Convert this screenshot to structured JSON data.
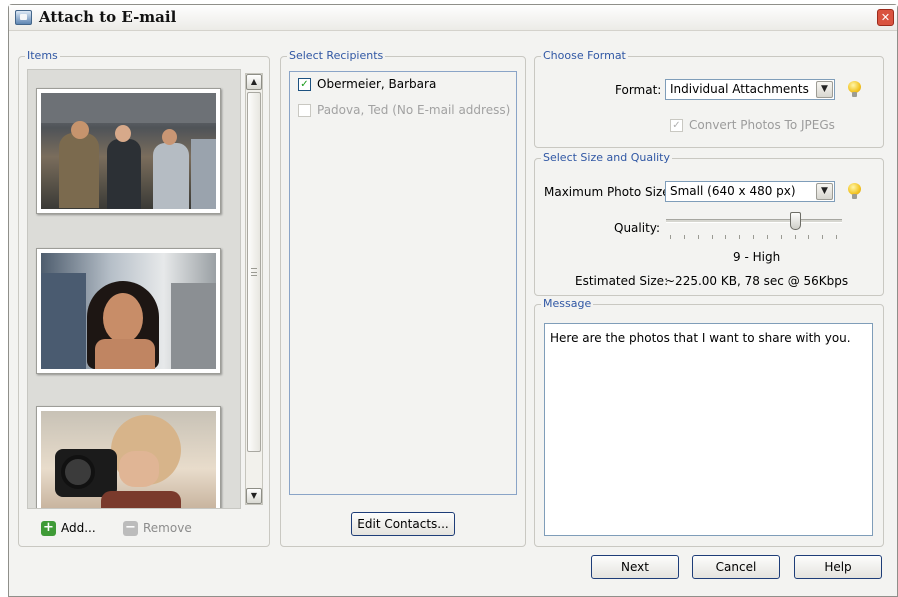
{
  "window": {
    "title": "Attach to E-mail",
    "close_icon": "close-icon",
    "close_glyph": "✕"
  },
  "items": {
    "label": "Items",
    "thumbnails": [
      {
        "description_icon": "photo-thumbnail"
      },
      {
        "description_icon": "photo-thumbnail"
      },
      {
        "description_icon": "photo-thumbnail"
      }
    ],
    "scroll_up_glyph": "▲",
    "scroll_down_glyph": "▼",
    "add_label": "Add...",
    "remove_label": "Remove",
    "add_glyph": "+",
    "remove_glyph": "−"
  },
  "recipients": {
    "label": "Select Recipients",
    "list": [
      {
        "name": "Obermeier, Barbara",
        "checked": true,
        "enabled": true,
        "check_glyph": "✓"
      },
      {
        "name": "Padova, Ted (No E-mail address)",
        "checked": false,
        "enabled": false,
        "check_glyph": ""
      }
    ],
    "edit_contacts_label": "Edit Contacts..."
  },
  "format": {
    "label": "Choose Format",
    "format_label": "Format:",
    "format_value": "Individual Attachments",
    "convert_label": "Convert Photos To JPEGs",
    "convert_checked": true,
    "convert_glyph": "✓"
  },
  "size_quality": {
    "label": "Select Size and Quality",
    "max_size_label": "Maximum Photo Size:",
    "max_size_value": "Small (640 x 480 px)",
    "quality_label": "Quality:",
    "quality_value": "9 - High",
    "quality_level": 9,
    "quality_max": 12,
    "estimated_label": "Estimated Size:",
    "estimated_value": "~225.00 KB, 78 sec @ 56Kbps"
  },
  "message": {
    "label": "Message",
    "text": "Here are the photos that I want to share with you."
  },
  "buttons": {
    "next": "Next",
    "cancel": "Cancel",
    "help": "Help"
  },
  "select_arrow_glyph": "▼",
  "colors": {
    "accent": "#3057a4",
    "button_border": "#1e3d78",
    "add_green": "#3f9b37"
  }
}
